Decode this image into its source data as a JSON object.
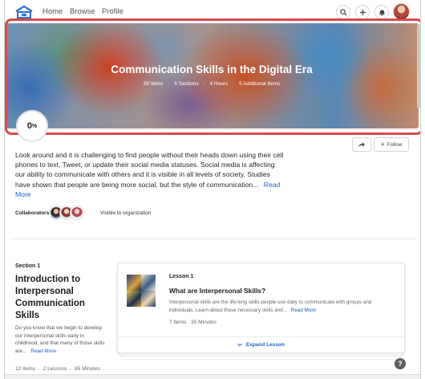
{
  "nav": {
    "links": [
      "Home",
      "Browse",
      "Profile"
    ],
    "icons": [
      "search-icon",
      "plus-icon",
      "bell-icon"
    ]
  },
  "hero": {
    "title": "Communication Skills in the Digital Era",
    "meta": [
      "39 Items",
      "6 Sections",
      "4 Hours",
      "5 Additional Items"
    ],
    "meta_sep": "·"
  },
  "progress": {
    "value": "0",
    "unit": "%"
  },
  "actions": {
    "share_icon": "share-icon",
    "follow_label": "Follow"
  },
  "description": {
    "text": "Look around and it is challenging to find people without their heads down using their cell phones to text, Tweet, or update their social media statuses. Social media is affecting our ability to communicate with others and it is visible in all levels of society. Studies have shown that people are being more social, but the style of communication...",
    "read_more": "Read More"
  },
  "collaborators": {
    "label": "Collaborators:",
    "visibility": "Visible to organization"
  },
  "section": {
    "label": "Section 1",
    "title": "Introduction to Interpersonal Communication Skills",
    "desc": "Do you know that we begin to develop our interpersonal skills early in childhood, and that many of those skills are...",
    "read_more": "Read More",
    "items": "12 Items",
    "lessons": "2 Lessons",
    "duration": "65 Minutes",
    "sep": "·"
  },
  "lesson": {
    "num": "Lesson 1",
    "title": "What are Interpersonal Skills?",
    "desc": "Interpersonal skills are the life-long skills people use daily to communicate with groups and individuals. Learn about these necessary skills and...",
    "read_more": "Read More",
    "items": "7 Items",
    "duration": "35 Minutes",
    "sep": "·",
    "expand": "Expand Lesson"
  },
  "help": {
    "label": "?"
  },
  "colors": {
    "accent": "#1a62c9",
    "highlight": "#d84b4b"
  }
}
